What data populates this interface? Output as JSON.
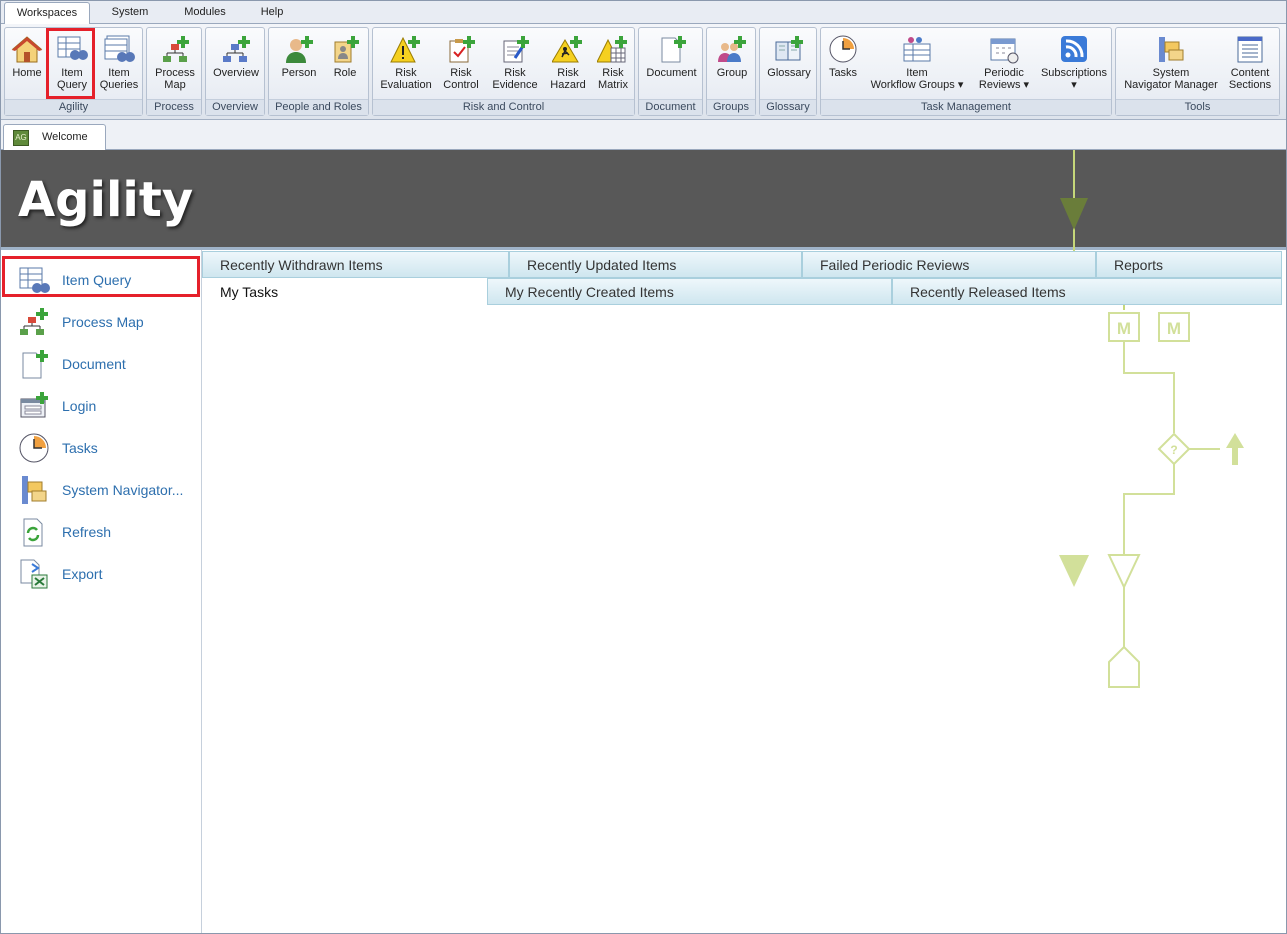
{
  "menu": {
    "tabs": [
      {
        "label": "Workspaces",
        "active": true
      },
      {
        "label": "System"
      },
      {
        "label": "Modules"
      },
      {
        "label": "Help"
      }
    ]
  },
  "ribbon": {
    "groups": [
      {
        "label": "Agility",
        "buttons": [
          {
            "label": "Home",
            "icon": "home-icon"
          },
          {
            "label": "Item\nQuery",
            "icon": "item-query-icon",
            "highlighted": true
          },
          {
            "label": "Item\nQueries",
            "icon": "item-queries-icon"
          }
        ]
      },
      {
        "label": "Process",
        "buttons": [
          {
            "label": "Process\nMap",
            "icon": "process-map-icon"
          }
        ]
      },
      {
        "label": "Overview",
        "buttons": [
          {
            "label": "Overview",
            "icon": "overview-icon"
          }
        ]
      },
      {
        "label": "People and Roles",
        "buttons": [
          {
            "label": "Person",
            "icon": "person-add-icon"
          },
          {
            "label": "Role",
            "icon": "role-add-icon"
          }
        ]
      },
      {
        "label": "Risk and Control",
        "buttons": [
          {
            "label": "Risk\nEvaluation",
            "icon": "risk-evaluation-icon"
          },
          {
            "label": "Risk\nControl",
            "icon": "risk-control-icon"
          },
          {
            "label": "Risk\nEvidence",
            "icon": "risk-evidence-icon"
          },
          {
            "label": "Risk\nHazard",
            "icon": "risk-hazard-icon"
          },
          {
            "label": "Risk\nMatrix",
            "icon": "risk-matrix-icon"
          }
        ]
      },
      {
        "label": "Document",
        "buttons": [
          {
            "label": "Document",
            "icon": "document-add-icon"
          }
        ]
      },
      {
        "label": "Groups",
        "buttons": [
          {
            "label": "Group",
            "icon": "group-add-icon"
          }
        ]
      },
      {
        "label": "Glossary",
        "buttons": [
          {
            "label": "Glossary",
            "icon": "glossary-icon"
          }
        ]
      },
      {
        "label": "Task Management",
        "buttons": [
          {
            "label": "Tasks",
            "icon": "clock-icon"
          },
          {
            "label": "Item\nWorkflow Groups ▾",
            "icon": "workflow-groups-icon"
          },
          {
            "label": "Periodic\nReviews ▾",
            "icon": "calendar-icon"
          },
          {
            "label": "Subscriptions\n▾",
            "icon": "rss-icon"
          }
        ]
      },
      {
        "label": "Tools",
        "buttons": [
          {
            "label": "System\nNavigator Manager",
            "icon": "system-navigator-icon"
          },
          {
            "label": "Content\nSections",
            "icon": "content-sections-icon"
          }
        ]
      }
    ]
  },
  "doc_tab": {
    "label": "Welcome",
    "icon": "agility-logo-icon"
  },
  "banner": {
    "title": "Agility"
  },
  "sidebar": {
    "items": [
      {
        "label": "Item Query",
        "icon": "item-query-icon",
        "highlighted": true
      },
      {
        "label": "Process Map",
        "icon": "process-map-icon"
      },
      {
        "label": "Document",
        "icon": "document-add-icon"
      },
      {
        "label": "Login",
        "icon": "login-icon"
      },
      {
        "label": "Tasks",
        "icon": "clock-icon"
      },
      {
        "label": "System Navigator...",
        "icon": "system-navigator-icon"
      },
      {
        "label": "Refresh",
        "icon": "refresh-icon"
      },
      {
        "label": "Export",
        "icon": "export-excel-icon"
      }
    ]
  },
  "main": {
    "tab_row_back": [
      "Recently Withdrawn Items",
      "Recently Updated Items",
      "Failed Periodic Reviews",
      "Reports"
    ],
    "tab_row_front": [
      "My Tasks",
      "My Recently Created Items",
      "Recently Released Items"
    ],
    "selected_tab": "My Tasks"
  },
  "colors": {
    "highlight": "#e5202a",
    "banner": "#585858",
    "sidebar_link": "#2d6fae",
    "tab_bg": "#cfe6ef"
  }
}
